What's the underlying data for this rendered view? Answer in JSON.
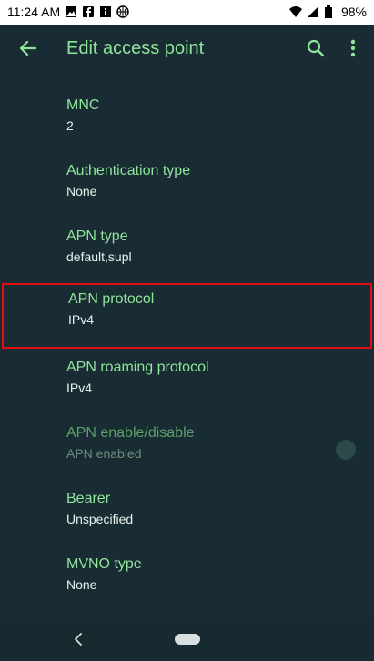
{
  "status_bar": {
    "time": "11:24 AM",
    "battery": "98%",
    "left_icons": [
      "image-icon",
      "facebook-icon",
      "info-icon",
      "basketball-icon"
    ],
    "right_icons": [
      "wifi-icon",
      "signal-icon",
      "battery-icon"
    ]
  },
  "app_bar": {
    "title": "Edit access point",
    "back_icon": "arrow-left-icon",
    "search_icon": "search-icon",
    "more_icon": "more-vert-icon"
  },
  "colors": {
    "background": "#1a2c33",
    "accent": "#8ee49a",
    "highlight_border": "#e01010"
  },
  "settings": [
    {
      "label": "MNC",
      "value": "2"
    },
    {
      "label": "Authentication type",
      "value": "None"
    },
    {
      "label": "APN type",
      "value": "default,supl"
    },
    {
      "label": "APN protocol",
      "value": "IPv4"
    },
    {
      "label": "APN roaming protocol",
      "value": "IPv4"
    },
    {
      "label": "APN enable/disable",
      "value": "APN enabled"
    },
    {
      "label": "Bearer",
      "value": "Unspecified"
    },
    {
      "label": "MVNO type",
      "value": "None"
    }
  ],
  "nav_bar": {
    "back_icon": "nav-back-icon",
    "home_icon": "home-pill-icon"
  }
}
